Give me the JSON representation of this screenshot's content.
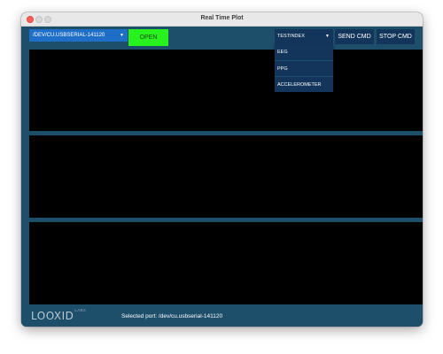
{
  "window": {
    "title": "Real Time Plot"
  },
  "toolbar": {
    "port_select": {
      "value": "/DEV/CU.USBSERIAL-141120"
    },
    "open_label": "OPEN",
    "command_select": {
      "value": "TESTINDEX"
    },
    "send_label": "SEND CMD",
    "stop_label": "STOP CMD"
  },
  "dropdown": {
    "items": [
      {
        "label": "EEG"
      },
      {
        "label": "PPG"
      },
      {
        "label": "ACCELEROMETER"
      }
    ]
  },
  "footer": {
    "logo_main": "LOOXID",
    "logo_sub": "LABS",
    "status": "Selected port: /dev/cu.usbserial-141120"
  },
  "colors": {
    "window_bg": "#1d4e6a",
    "port_select_bg": "#1f6fc9",
    "open_button_bg": "#27f21d",
    "dark_button_bg": "#13355b",
    "plot_bg": "#000000"
  }
}
